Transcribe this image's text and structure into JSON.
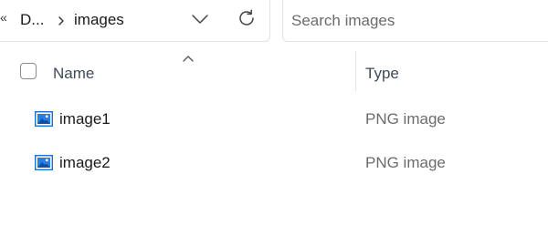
{
  "toolbar": {
    "overflow_chevron": "«",
    "breadcrumb": [
      "D...",
      "images"
    ],
    "history_icon": "chevron-down-icon",
    "refresh_icon": "refresh-icon"
  },
  "search": {
    "placeholder": "Search images",
    "value": ""
  },
  "columns": {
    "name_label": "Name",
    "type_label": "Type",
    "sort_direction": "ascending"
  },
  "files": [
    {
      "name": "image1",
      "type": "PNG image",
      "icon": "png-image-icon"
    },
    {
      "name": "image2",
      "type": "PNG image",
      "icon": "png-image-icon"
    }
  ],
  "colors": {
    "icon_blue": "#1f6fd1",
    "header_text": "#3f4a57",
    "secondary_text": "#6b6b6b"
  }
}
